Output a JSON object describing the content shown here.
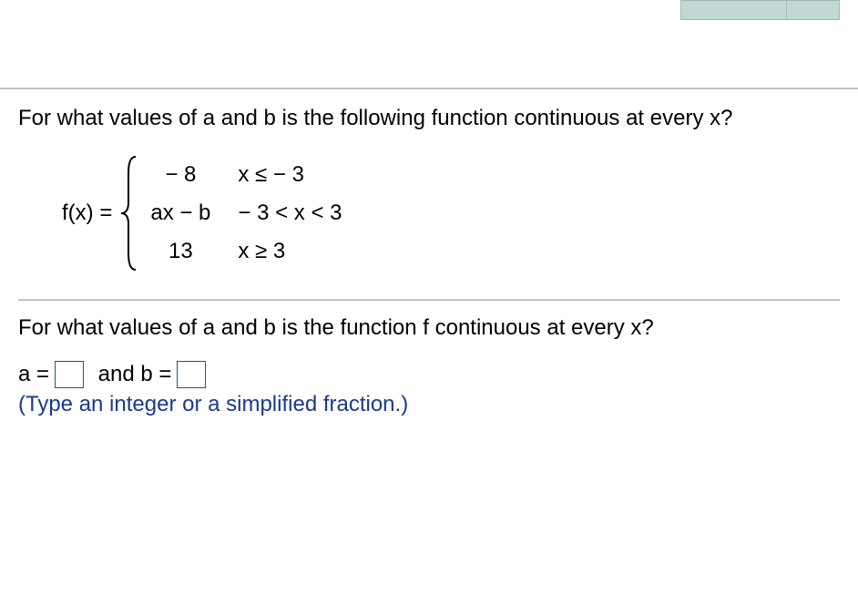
{
  "question": "For what values of a and b is the following function continuous at every x?",
  "function_label": "f(x) =",
  "piecewise": {
    "row1_val": "− 8",
    "row1_cond": "x ≤  − 3",
    "row2_val": "ax − b",
    "row2_cond": "− 3 < x < 3",
    "row3_val": "13",
    "row3_cond": "x ≥ 3"
  },
  "sub_question": "For what values of a and b is the function f continuous at every x?",
  "answer_prefix_a": "a =",
  "answer_mid": "and b =",
  "hint": "(Type an integer or a simplified fraction.)"
}
